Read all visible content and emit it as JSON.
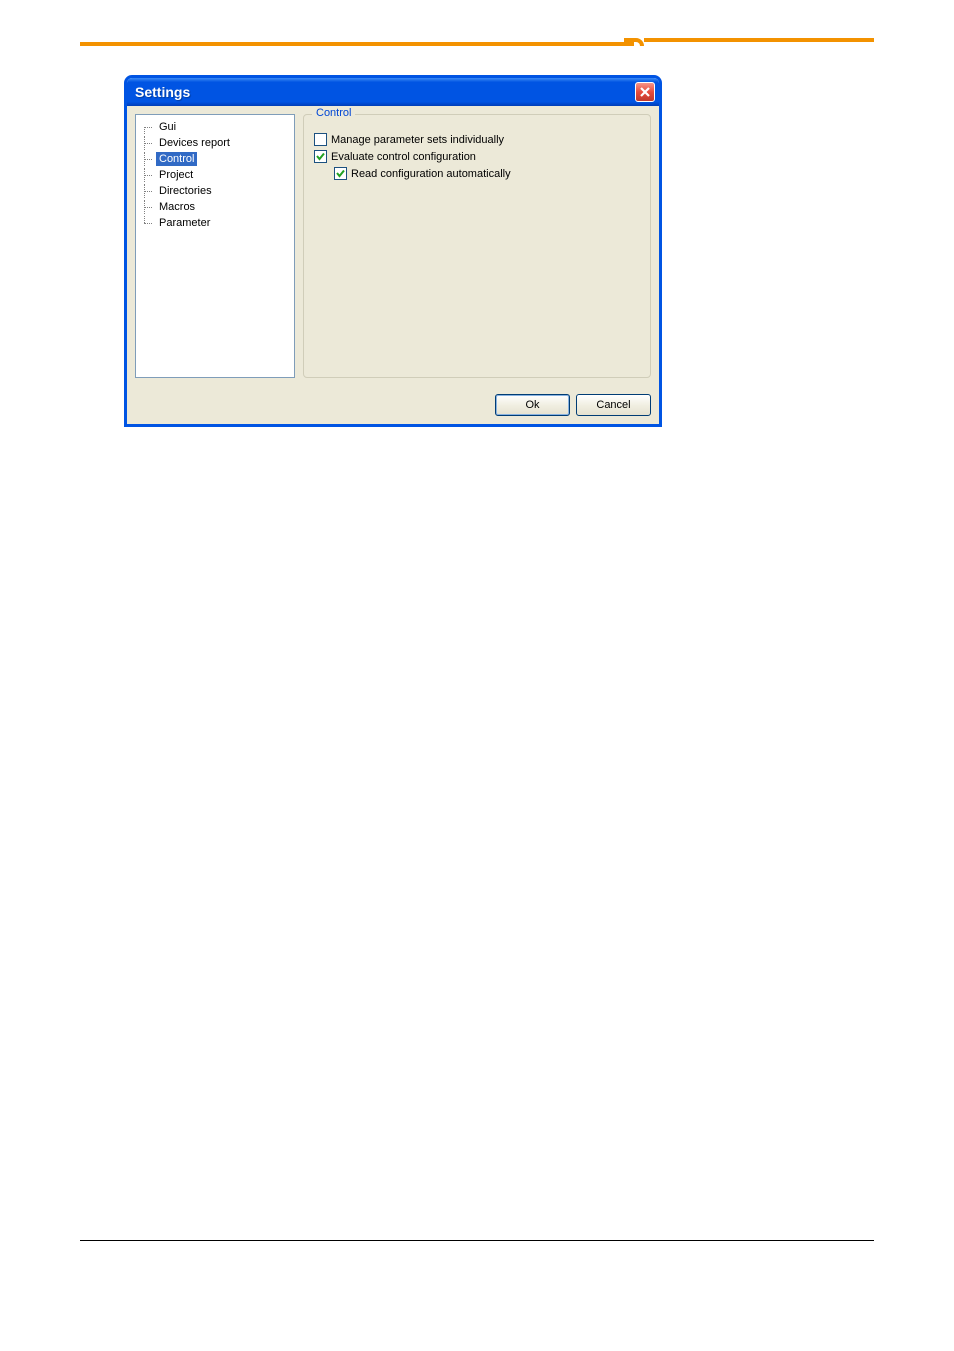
{
  "dialog": {
    "title": "Settings",
    "tree": {
      "items": [
        {
          "label": "Gui",
          "selected": false
        },
        {
          "label": "Devices report",
          "selected": false
        },
        {
          "label": "Control",
          "selected": true
        },
        {
          "label": "Project",
          "selected": false
        },
        {
          "label": "Directories",
          "selected": false
        },
        {
          "label": "Macros",
          "selected": false
        },
        {
          "label": "Parameter",
          "selected": false
        }
      ]
    },
    "panel": {
      "title": "Control",
      "options": [
        {
          "label": "Manage parameter sets individually",
          "checked": false,
          "indent": 0
        },
        {
          "label": "Evaluate control configuration",
          "checked": true,
          "indent": 0
        },
        {
          "label": "Read configuration automatically",
          "checked": true,
          "indent": 1
        }
      ]
    },
    "buttons": {
      "ok": "Ok",
      "cancel": "Cancel"
    }
  }
}
